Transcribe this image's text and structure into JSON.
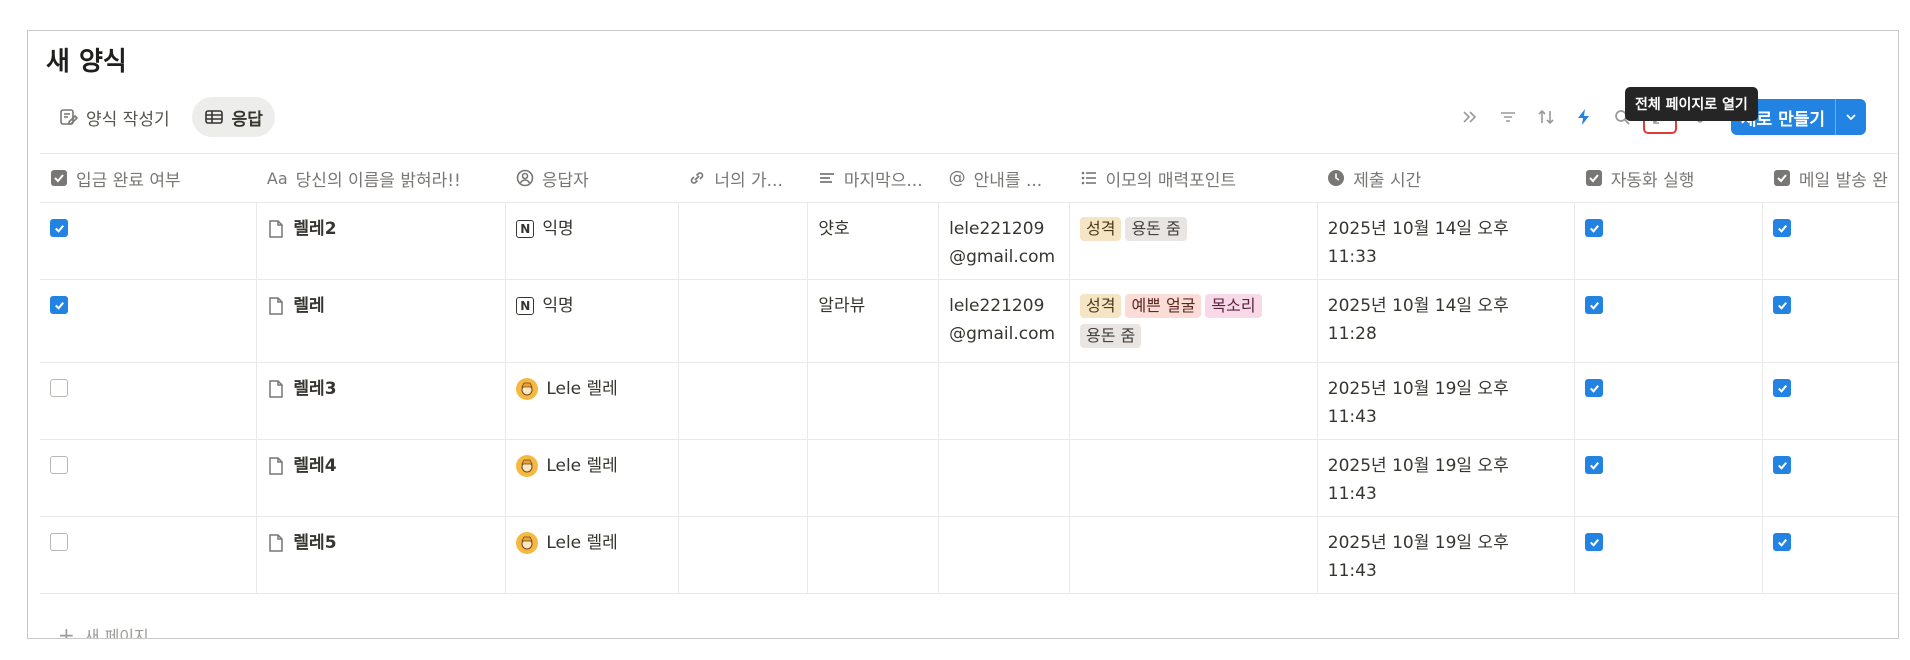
{
  "page": {
    "title": "새 양식"
  },
  "tabs": [
    {
      "label": "양식 작성기",
      "icon": "form-edit-icon"
    },
    {
      "label": "응답",
      "icon": "table-icon",
      "active": true
    }
  ],
  "toolbar": {
    "tooltip": "전체 페이지로 열기",
    "new_label": "새로 만들기",
    "accent": "#2383e2"
  },
  "table": {
    "columns": [
      {
        "label": "입금 완료 여부",
        "icon": "checkbox-icon"
      },
      {
        "label": "당신의 이름을 밝혀라!!",
        "icon": "text-aa-icon"
      },
      {
        "label": "응답자",
        "icon": "person-icon"
      },
      {
        "label": "너의 가...",
        "icon": "link-icon"
      },
      {
        "label": "마지막으...",
        "icon": "lines-icon"
      },
      {
        "label": "안내를 ...",
        "icon": "at-icon"
      },
      {
        "label": "이모의 매력포인트",
        "icon": "list-icon"
      },
      {
        "label": "제출 시간",
        "icon": "clock-icon"
      },
      {
        "label": "자동화 실행",
        "icon": "checkbox-icon"
      },
      {
        "label": "메일 발송 완",
        "icon": "checkbox-icon"
      }
    ],
    "rows": [
      {
        "paid": true,
        "name": "렐레2",
        "respondent": "익명",
        "respondent_type": "notion",
        "link": "",
        "last": "얏호",
        "email_1": "lele221209",
        "email_2": "@gmail.com",
        "tags": [
          {
            "text": "성격",
            "bg": "#f6e5c5",
            "fg": "#4a3a1a"
          },
          {
            "text": "용돈 줌",
            "bg": "#e9e5e3",
            "fg": "#45403a"
          }
        ],
        "time_1": "2025년 10월 14일 오후",
        "time_2": "11:33",
        "auto": true,
        "mail": true
      },
      {
        "paid": true,
        "name": "렐레",
        "respondent": "익명",
        "respondent_type": "notion",
        "link": "",
        "last": "알라뷰",
        "email_1": "lele221209",
        "email_2": "@gmail.com",
        "tags": [
          {
            "text": "성격",
            "bg": "#f6e5c5",
            "fg": "#4a3a1a"
          },
          {
            "text": "예쁜 얼굴",
            "bg": "#fbdcd7",
            "fg": "#5a2a22"
          },
          {
            "text": "목소리",
            "bg": "#f7d9e8",
            "fg": "#5a2240"
          },
          {
            "text": "용돈 줌",
            "bg": "#e9e5e3",
            "fg": "#45403a"
          }
        ],
        "time_1": "2025년 10월 14일 오후",
        "time_2": "11:28",
        "auto": true,
        "mail": true
      },
      {
        "paid": false,
        "name": "렐레3",
        "respondent": "Lele 렐레",
        "respondent_type": "avatar",
        "link": "",
        "last": "",
        "email_1": "",
        "email_2": "",
        "tags": [],
        "time_1": "2025년 10월 19일 오후",
        "time_2": "11:43",
        "auto": true,
        "mail": true
      },
      {
        "paid": false,
        "name": "렐레4",
        "respondent": "Lele 렐레",
        "respondent_type": "avatar",
        "link": "",
        "last": "",
        "email_1": "",
        "email_2": "",
        "tags": [],
        "time_1": "2025년 10월 19일 오후",
        "time_2": "11:43",
        "auto": true,
        "mail": true
      },
      {
        "paid": false,
        "name": "렐레5",
        "respondent": "Lele 렐레",
        "respondent_type": "avatar",
        "link": "",
        "last": "",
        "email_1": "",
        "email_2": "",
        "tags": [],
        "time_1": "2025년 10월 19일 오후",
        "time_2": "11:43",
        "auto": true,
        "mail": true
      }
    ],
    "add_row_label": "새 페이지"
  }
}
